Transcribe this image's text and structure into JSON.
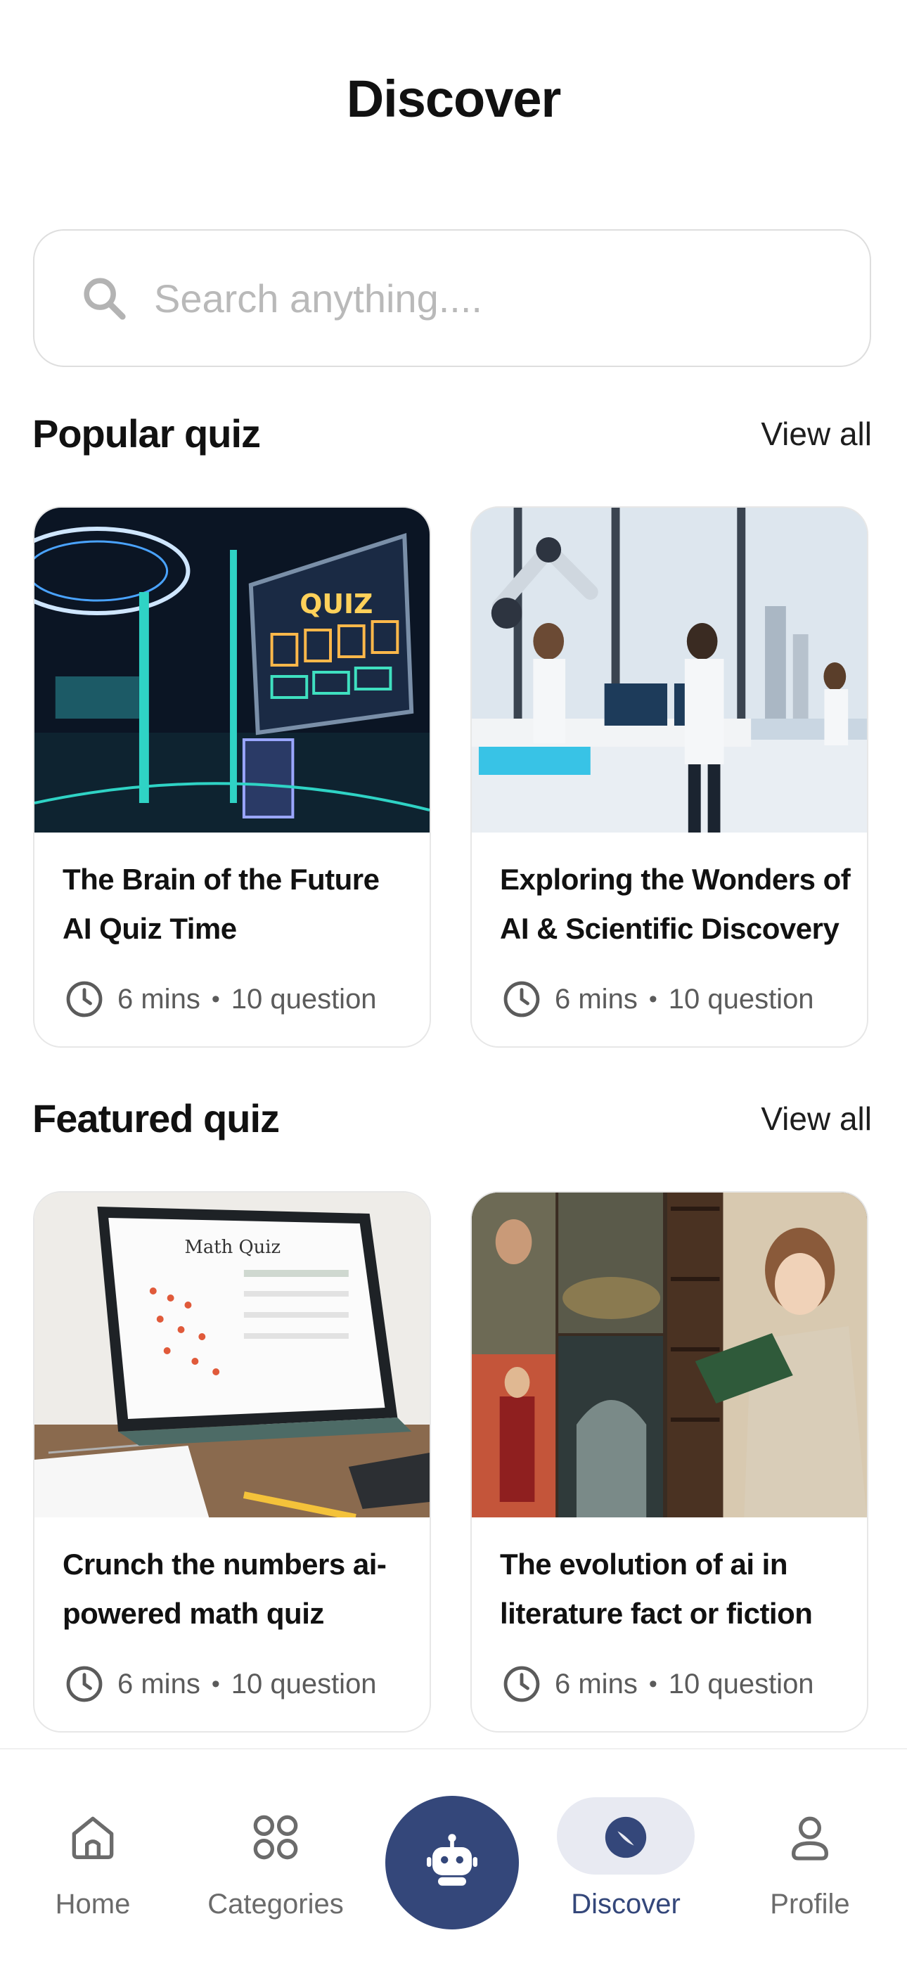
{
  "header": {
    "title": "Discover"
  },
  "search": {
    "placeholder": "Search anything...."
  },
  "sections": [
    {
      "title": "Popular quiz",
      "view_all": "View all",
      "cards": [
        {
          "title": "The Brain of the Future AI Quiz Time",
          "duration": "6 mins",
          "questions": "10 question",
          "image": "quiz-stage-image"
        },
        {
          "title": "Exploring the Wonders of AI & Scientific Discovery",
          "duration": "6 mins",
          "questions": "10 question",
          "image": "robot-lab-image"
        }
      ]
    },
    {
      "title": "Featured quiz",
      "view_all": "View all",
      "cards": [
        {
          "title": "Crunch the numbers ai-powered math quiz",
          "duration": "6 mins",
          "questions": "10 question",
          "image": "math-tablet-image"
        },
        {
          "title": "The evolution of ai in literature fact or fiction",
          "duration": "6 mins",
          "questions": "10 question",
          "image": "reading-books-image"
        }
      ]
    }
  ],
  "nav": {
    "items": [
      {
        "label": "Home",
        "icon": "home-icon"
      },
      {
        "label": "Categories",
        "icon": "grid-icon"
      },
      {
        "label": "",
        "icon": "robot-icon"
      },
      {
        "label": "Discover",
        "icon": "compass-icon",
        "active": true
      },
      {
        "label": "Profile",
        "icon": "user-icon"
      }
    ]
  },
  "colors": {
    "accent": "#34477a",
    "accent_soft": "#e8eaf2",
    "text": "#111111",
    "muted": "#5b5b5b"
  }
}
